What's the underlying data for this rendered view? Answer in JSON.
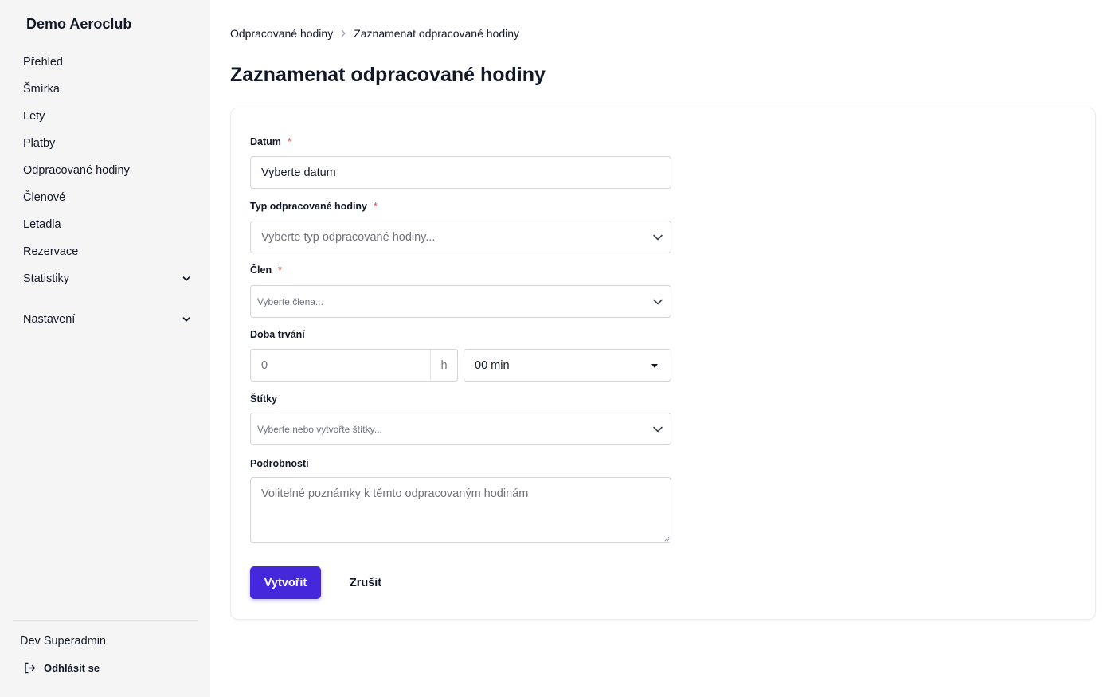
{
  "sidebar": {
    "brand": "Demo Aeroclub",
    "items": [
      {
        "label": "Přehled"
      },
      {
        "label": "Šmírka"
      },
      {
        "label": "Lety"
      },
      {
        "label": "Platby"
      },
      {
        "label": "Odpracované hodiny"
      },
      {
        "label": "Členové"
      },
      {
        "label": "Letadla"
      },
      {
        "label": "Rezervace"
      },
      {
        "label": "Statistiky",
        "expandable": true
      },
      {
        "label": "Nastavení",
        "expandable": true
      }
    ],
    "user_name": "Dev Superadmin",
    "logout_label": "Odhlásit se"
  },
  "breadcrumb": {
    "parent": "Odpracované hodiny",
    "current": "Zaznamenat odpracované hodiny"
  },
  "page": {
    "title": "Zaznamenat odpracované hodiny"
  },
  "form": {
    "date": {
      "label": "Datum",
      "required_mark": "*",
      "value": "Vyberte datum"
    },
    "type": {
      "label": "Typ odpracované hodiny",
      "required_mark": "*",
      "placeholder": "Vyberte typ odpracované hodiny..."
    },
    "member": {
      "label": "Člen",
      "required_mark": "*",
      "placeholder": "Vyberte člena..."
    },
    "duration": {
      "label": "Doba trvání",
      "hours_placeholder": "0",
      "hours_unit": "h",
      "minutes_value": "00 min"
    },
    "tags": {
      "label": "Štítky",
      "placeholder": "Vyberte nebo vytvořte štítky..."
    },
    "details": {
      "label": "Podrobnosti",
      "placeholder": "Volitelné poznámky k těmto odpracovaným hodinám"
    },
    "submit_label": "Vytvořit",
    "cancel_label": "Zrušit"
  },
  "colors": {
    "primary": "#4528dc",
    "required": "#ef4444",
    "sidebar_bg": "#f5f5f5"
  }
}
